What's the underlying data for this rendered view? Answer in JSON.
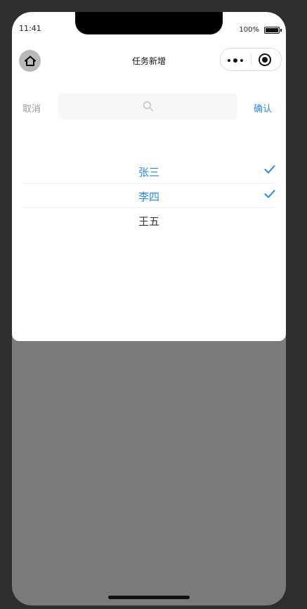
{
  "status_bar": {
    "time": "11:41",
    "battery": "100%"
  },
  "nav": {
    "title": "任务新增",
    "home_icon": "home-icon",
    "menu_icon": "more-dots-icon",
    "close_icon": "record-icon"
  },
  "picker": {
    "cancel_label": "取消",
    "confirm_label": "确认",
    "search_placeholder": "",
    "search_icon": "search-icon",
    "items": [
      {
        "label": "张三",
        "selected": true
      },
      {
        "label": "李四",
        "selected": true
      },
      {
        "label": "王五",
        "selected": false
      }
    ]
  },
  "colors": {
    "accent": "#2b86e0",
    "overlay": "#7b7b7b",
    "text": "#333333",
    "muted": "#999999"
  }
}
